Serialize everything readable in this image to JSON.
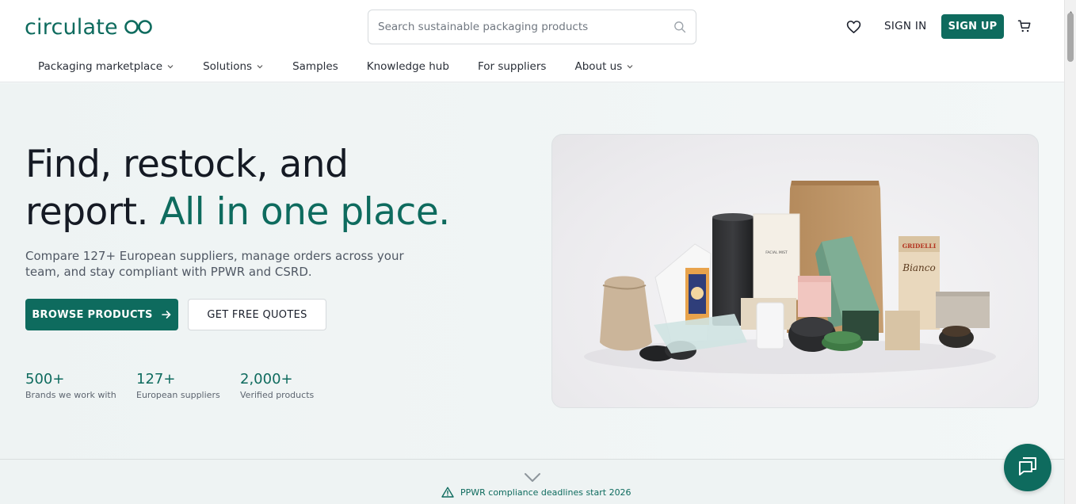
{
  "header": {
    "logo_text": "circulate",
    "search": {
      "placeholder": "Search sustainable packaging products",
      "value": ""
    },
    "signin_label": "SIGN IN",
    "signup_label": "SIGN UP"
  },
  "nav": {
    "items": [
      {
        "label": "Packaging marketplace",
        "dropdown": true
      },
      {
        "label": "Solutions",
        "dropdown": true
      },
      {
        "label": "Samples",
        "dropdown": false
      },
      {
        "label": "Knowledge hub",
        "dropdown": false
      },
      {
        "label": "For suppliers",
        "dropdown": false
      },
      {
        "label": "About us",
        "dropdown": true
      }
    ]
  },
  "hero": {
    "headline_line1": "Find, restock, and",
    "headline_line2_plain": "report. ",
    "headline_line2_accent": "All in one place.",
    "subtext": "Compare 127+ European suppliers, manage orders across your team, and stay compliant with PPWR and CSRD.",
    "primary_button": "BROWSE PRODUCTS",
    "secondary_button": "GET FREE QUOTES",
    "stats": [
      {
        "value": "500+",
        "label": "Brands we work with"
      },
      {
        "value": "127+",
        "label": "European suppliers"
      },
      {
        "value": "2,000+",
        "label": "Verified products"
      }
    ],
    "image_labels": {
      "brand_box": "GRIDELLI",
      "brand_box_sub": "Bianco",
      "white_box": "FACIAL MIST"
    }
  },
  "notice": {
    "text": "PPWR compliance deadlines start 2026"
  },
  "colors": {
    "brand": "#0e6b5e",
    "text": "#151a24",
    "background": "#f4f7f7"
  },
  "icons": [
    "heart-icon",
    "cart-icon",
    "search-icon",
    "chevron-down-icon",
    "arrow-right-icon",
    "warning-icon",
    "chat-icon"
  ]
}
